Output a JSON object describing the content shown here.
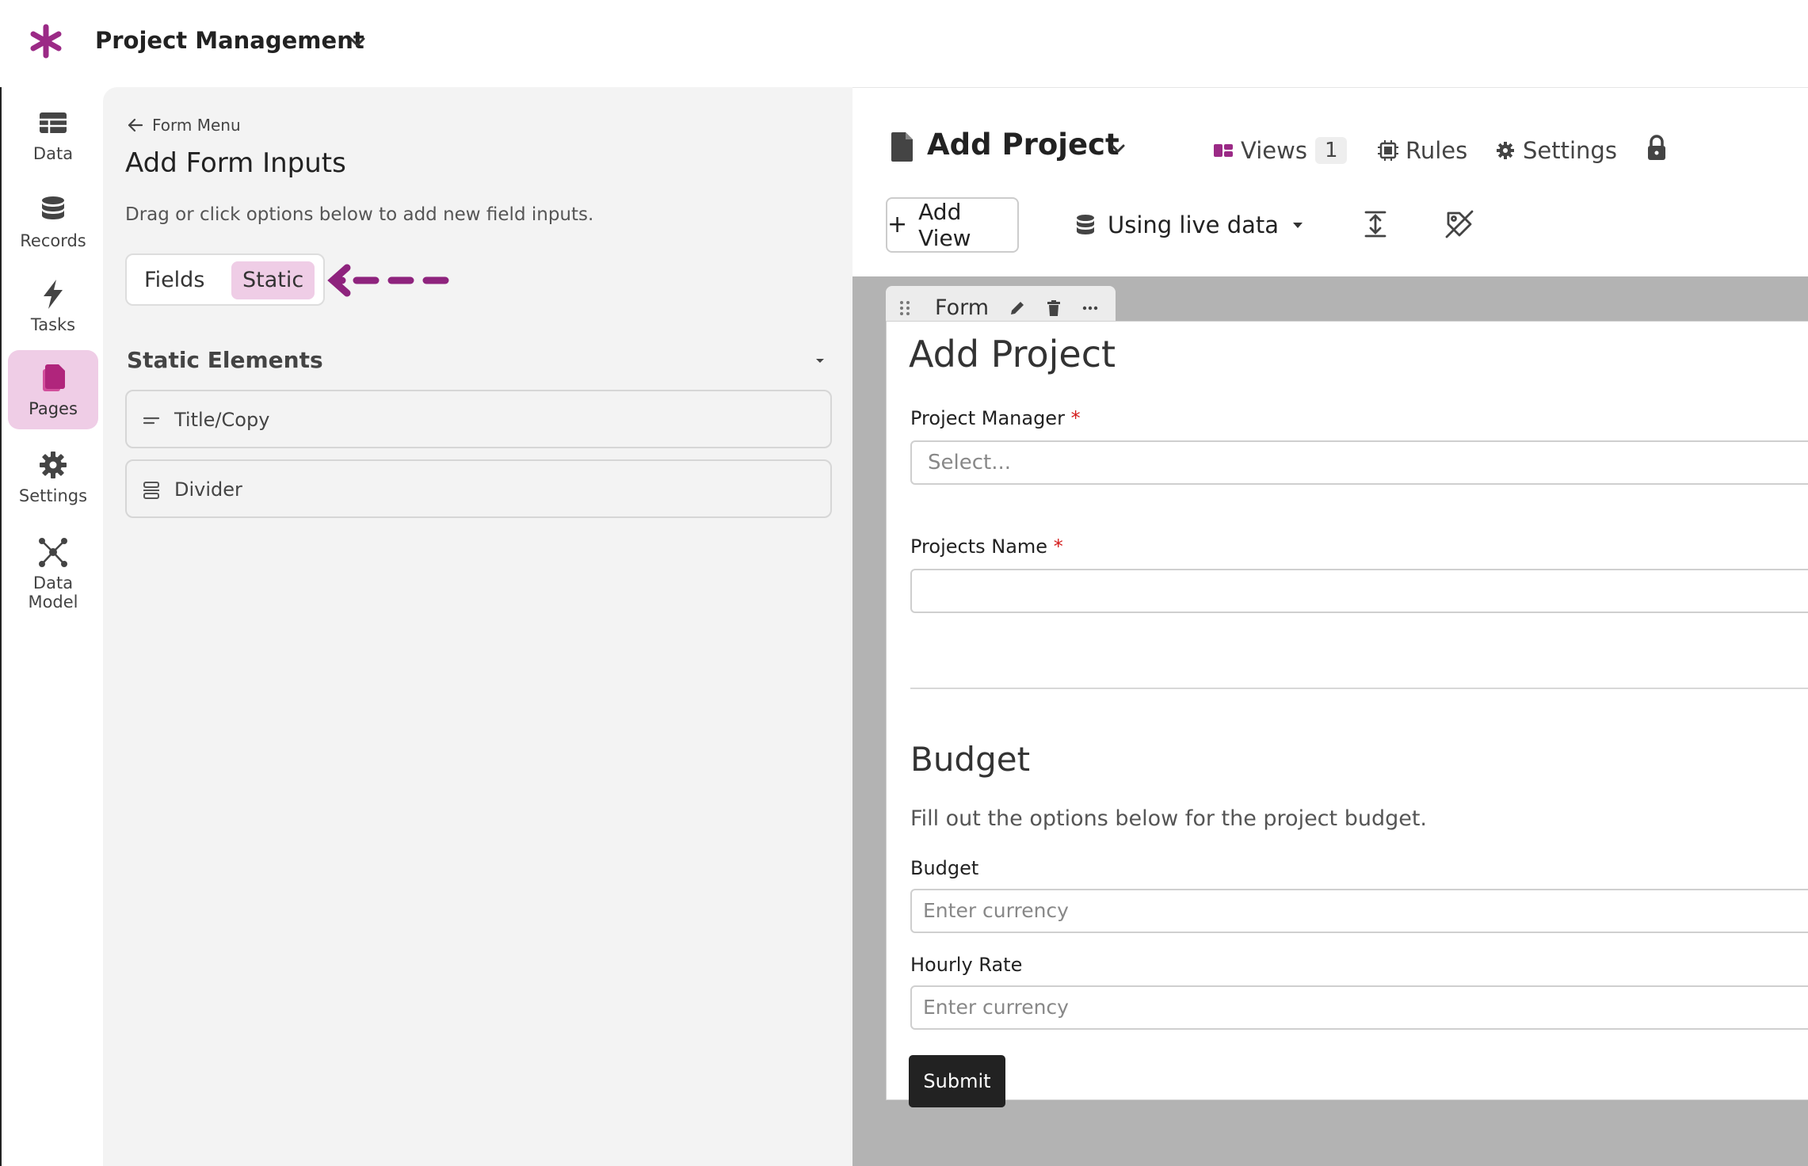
{
  "app": {
    "title": "Project Management"
  },
  "nav": {
    "items": [
      {
        "label": "Data",
        "icon": "table-icon"
      },
      {
        "label": "Records",
        "icon": "database-icon"
      },
      {
        "label": "Tasks",
        "icon": "lightning-icon"
      },
      {
        "label": "Pages",
        "icon": "pages-icon",
        "active": true
      },
      {
        "label": "Settings",
        "icon": "gear-icon"
      },
      {
        "label": "Data Model",
        "icon": "data-model-icon"
      }
    ]
  },
  "builder": {
    "back_label": "Form Menu",
    "title": "Add Form Inputs",
    "description": "Drag or click options below to add new field inputs.",
    "toggle": {
      "fields": "Fields",
      "static": "Static",
      "selected": "Static"
    },
    "section_title": "Static Elements",
    "elements": [
      {
        "label": "Title/Copy",
        "icon": "text-lines-icon"
      },
      {
        "label": "Divider",
        "icon": "divider-icon"
      }
    ]
  },
  "page": {
    "title": "Add Project",
    "views_label": "Views",
    "views_count": "1",
    "rules_label": "Rules",
    "settings_label": "Settings",
    "add_view_label": "Add View",
    "live_data_label": "Using live data"
  },
  "form": {
    "tab_label": "Form",
    "heading": "Add Project",
    "fields": [
      {
        "label": "Project Manager",
        "required_mark": "*",
        "placeholder": "Select..."
      },
      {
        "label": "Projects Name",
        "required_mark": "*",
        "placeholder": ""
      }
    ],
    "budget_section": {
      "title": "Budget",
      "description": "Fill out the options below for the project budget."
    },
    "currency_fields": [
      {
        "label": "Budget",
        "placeholder": "Enter currency"
      },
      {
        "label": "Hourly Rate",
        "placeholder": "Enter currency"
      }
    ],
    "submit_label": "Submit"
  },
  "colors": {
    "accent": "#9b2a86",
    "active_bg": "#efcde6",
    "canvas_bg": "#b3b3b3",
    "panel_bg": "#f3f3f3",
    "required": "#d41c1c"
  }
}
